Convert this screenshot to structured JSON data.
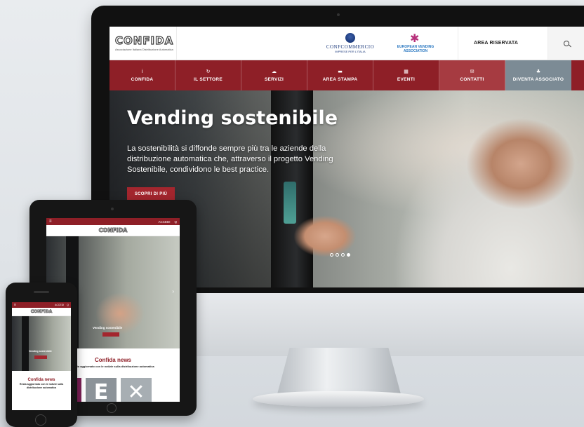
{
  "desktop": {
    "logo": {
      "wordmark": "CONFIDA",
      "tagline": "Associazione Italiana Distribuzione Automatica"
    },
    "partners": [
      {
        "name": "CONFCOMMERCIO",
        "sub": "IMPRESE PER L'ITALIA",
        "icon": "confcommercio-emblem-icon"
      },
      {
        "name": "EUROPEAN VENDING ASSOCIATION",
        "icon": "eva-star-icon"
      }
    ],
    "header_link": "AREA RISERVATA",
    "nav": [
      {
        "label": "CONFIDA",
        "icon": "i"
      },
      {
        "label": "IL SETTORE",
        "icon": "↻"
      },
      {
        "label": "SERVIZI",
        "icon": "☁"
      },
      {
        "label": "AREA STAMPA",
        "icon": "▬"
      },
      {
        "label": "EVENTI",
        "icon": "▦"
      },
      {
        "label": "CONTATTI",
        "icon": "✉"
      },
      {
        "label": "DIVENTA ASSOCIATO",
        "icon": "♣"
      }
    ],
    "hero": {
      "title": "Vending sostenibile",
      "text": "La sostenibilità si diffonde sempre più tra le aziende della distribuzione automatica che, attraverso il progetto Vending Sostenibile, condividono le best practice.",
      "cta": "SCOPRI DI PIÙ",
      "slides_total": 4,
      "active_slide": 4
    }
  },
  "tablet": {
    "top_links": [
      "ACCEDI",
      "Q"
    ],
    "logo": "CONFIDA",
    "hero_title": "Vending sostenibile",
    "news_title": "Confida news",
    "news_sub": "Resta aggiornato con le notizie sulla distribuzione automatica",
    "tiles": [
      "V",
      "E",
      "✕"
    ]
  },
  "phone": {
    "top_links": [
      "ACCEDI",
      "Q"
    ],
    "logo": "CONFIDA",
    "hero_title": "Vending sostenibile",
    "news_title": "Confida news",
    "news_sub": "Resta aggiornato con le notizie sulla distribuzione automatica"
  },
  "colors": {
    "brand": "#8e1f27",
    "cta": "#a3262e",
    "secondary_nav": "#7c8b95"
  }
}
